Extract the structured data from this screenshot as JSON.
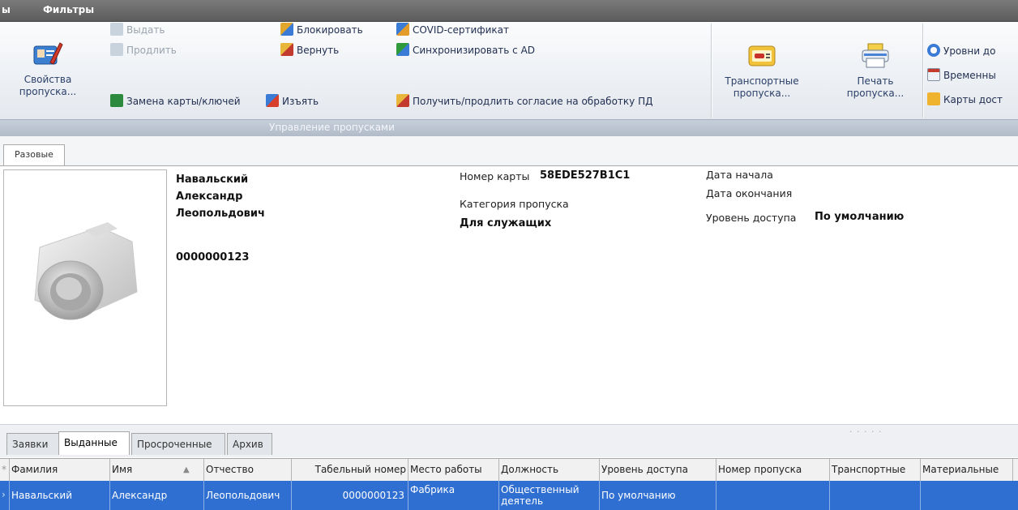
{
  "menubar": {
    "left_fragment": "ы",
    "filters": "Фильтры"
  },
  "ribbon": {
    "props_btn": "Свойства пропуска...",
    "issue": "Выдать",
    "extend": "Продлить",
    "replace_card": "Замена карты/ключей",
    "block": "Блокировать",
    "return": "Вернуть",
    "seize": "Изъять",
    "covid": "COVID-сертификат",
    "sync_ad": "Синхронизировать с AD",
    "consent": "Получить/продлить согласие на обработку ПД",
    "transport_btn": "Транспортные пропуска...",
    "print_btn": "Печать пропуска...",
    "access_levels": "Уровни до",
    "temporary": "Временны",
    "access_cards": "Карты дост",
    "group_label": "Управление пропусками"
  },
  "upper_tab": "Разовые",
  "person": {
    "last": "Навальский",
    "first": "Александр",
    "middle": "Леопольдович",
    "number": "0000000123"
  },
  "card": {
    "number_label": "Номер карты",
    "number_value": "58EDE527B1C1",
    "category_label": "Категория пропуска",
    "category_value": "Для служащих",
    "start_label": "Дата начала",
    "end_label": "Дата окончания",
    "level_label": "Уровень доступа",
    "level_value": "По умолчанию"
  },
  "lower_tabs": [
    "Заявки",
    "Выданные",
    "Просроченные",
    "Архив"
  ],
  "table": {
    "columns": [
      "Фамилия",
      "Имя",
      "Отчество",
      "Табельный номер",
      "Место работы",
      "Должность",
      "Уровень доступа",
      "Номер пропуска",
      "Транспортные",
      "Материальные"
    ],
    "row": [
      "Навальский",
      "Александр",
      "Леопольдович",
      "0000000123",
      "Фабрика",
      "Общественный деятель",
      "По умолчанию",
      "",
      "",
      ""
    ]
  },
  "colors": {
    "selection": "#2f6fd1",
    "menubar": "#666666",
    "ribbon_text": "#1f2d4f"
  }
}
